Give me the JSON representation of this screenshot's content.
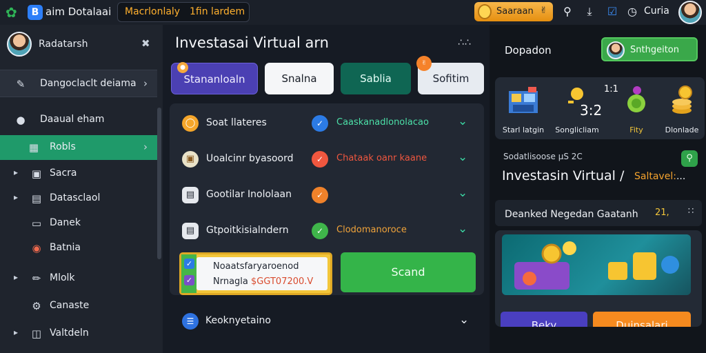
{
  "topbar": {
    "app_name": "aim Dotalaai",
    "search_a": "Macrlonlaly",
    "search_b": "1fin lardem",
    "coin_label": "Saaraan",
    "user_name": "Curia"
  },
  "sidebar": {
    "user_name": "Radatarsh",
    "items": [
      {
        "label": "Dangoclaclt deiama"
      },
      {
        "label": "Daaual eham"
      },
      {
        "label": "Robls"
      },
      {
        "label": "Sacra"
      },
      {
        "label": "Datasclaol"
      },
      {
        "label": "Danek"
      },
      {
        "label": "Batnia"
      },
      {
        "label": "Mlolk"
      },
      {
        "label": "Canaste"
      },
      {
        "label": "Valtdeln"
      }
    ]
  },
  "main": {
    "title": "Investasai Virtual arn",
    "dots": "∴∴",
    "tabs": [
      {
        "label": "Stananloaln"
      },
      {
        "label": "Snalna"
      },
      {
        "label": "Sablia"
      },
      {
        "label": "Sofitim"
      }
    ],
    "rows": [
      {
        "label": "Soat llateres",
        "status": "Caaskanadlonolacao",
        "status_color": "#4ce0a8"
      },
      {
        "label": "Uoalcinr byasoord",
        "status": "Chataak oanr kaane",
        "status_color": "#f0573f"
      },
      {
        "label": "Gootilar Inololaan",
        "status": ""
      },
      {
        "label": "Gtpoitkisialndern",
        "status": "Clodomanoroce",
        "status_color": "#f0a33a"
      }
    ],
    "select": {
      "line1": "Noaatsfaryaroenod",
      "line2_a": "Nrnagla",
      "line2_b": "$GGT07200.V"
    },
    "send_label": "Scand",
    "accordion_label": "Keoknyetaino"
  },
  "right": {
    "title": "Dopadon",
    "pill_label": "Snthgeiton",
    "stats": [
      {
        "label": "Starl latgin"
      },
      {
        "label": "Songlicliam"
      },
      {
        "label": "Fity"
      },
      {
        "label": "Dlonlade"
      }
    ],
    "num_a": "3:2",
    "num_b": "1:1",
    "inv_small": "Sodatlisoose µS 2C",
    "inv_title": "Investasin Virtual /",
    "inv_sub_a": "Saltavel:",
    "inv_sub_b": "...",
    "deal_label": "Deanked Negedan Gaatanh",
    "deal_value": "21,",
    "deal_dots": "∷",
    "busy_label": "Beky",
    "download_label": "Duinsalari"
  },
  "colors": {
    "accent_green": "#34b449",
    "accent_orange": "#f58a1f",
    "accent_purple": "#4a3fc0",
    "accent_teal": "#0f6653"
  }
}
